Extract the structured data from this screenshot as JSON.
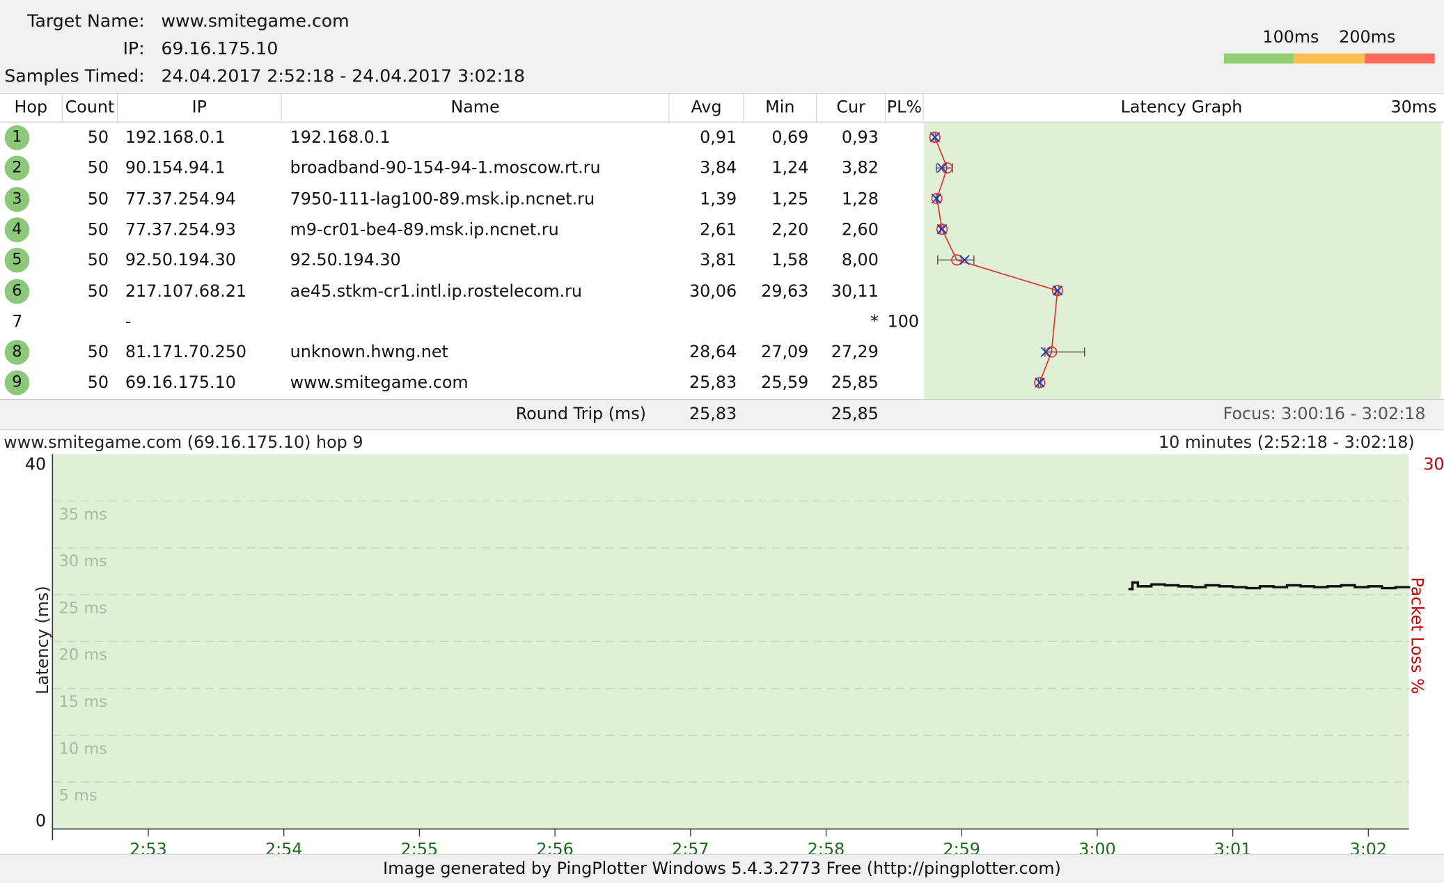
{
  "header": {
    "target_label": "Target Name:",
    "target_value": "www.smitegame.com",
    "ip_label": "IP:",
    "ip_value": "69.16.175.10",
    "samples_label": "Samples Timed:",
    "samples_value": "24.04.2017 2:52:18 - 24.04.2017 3:02:18",
    "legend_100": "100ms",
    "legend_200": "200ms",
    "legend_colors": [
      "#92cf72",
      "#fbbf4f",
      "#fb6a5a"
    ]
  },
  "columns": {
    "hop": "Hop",
    "count": "Count",
    "ip": "IP",
    "name": "Name",
    "avg": "Avg",
    "min": "Min",
    "cur": "Cur",
    "pl": "PL%",
    "graph": "Latency Graph",
    "scale": "30ms"
  },
  "hops": [
    {
      "hop": "1",
      "count": "50",
      "ip": "192.168.0.1",
      "name": "192.168.0.1",
      "avg": "0,91",
      "min": "0,69",
      "cur": "0,93",
      "pl": "",
      "responding": true
    },
    {
      "hop": "2",
      "count": "50",
      "ip": "90.154.94.1",
      "name": "broadband-90-154-94-1.moscow.rt.ru",
      "avg": "3,84",
      "min": "1,24",
      "cur": "3,82",
      "pl": "",
      "responding": true
    },
    {
      "hop": "3",
      "count": "50",
      "ip": "77.37.254.94",
      "name": "7950-111-lag100-89.msk.ip.ncnet.ru",
      "avg": "1,39",
      "min": "1,25",
      "cur": "1,28",
      "pl": "",
      "responding": true
    },
    {
      "hop": "4",
      "count": "50",
      "ip": "77.37.254.93",
      "name": "m9-cr01-be4-89.msk.ip.ncnet.ru",
      "avg": "2,61",
      "min": "2,20",
      "cur": "2,60",
      "pl": "",
      "responding": true
    },
    {
      "hop": "5",
      "count": "50",
      "ip": "92.50.194.30",
      "name": "92.50.194.30",
      "avg": "3,81",
      "min": "1,58",
      "cur": "8,00",
      "pl": "",
      "responding": true
    },
    {
      "hop": "6",
      "count": "50",
      "ip": "217.107.68.21",
      "name": "ae45.stkm-cr1.intl.ip.rostelecom.ru",
      "avg": "30,06",
      "min": "29,63",
      "cur": "30,11",
      "pl": "",
      "responding": true
    },
    {
      "hop": "7",
      "count": "",
      "ip": "-",
      "name": "",
      "avg": "",
      "min": "",
      "cur": "*",
      "pl": "100",
      "responding": false
    },
    {
      "hop": "8",
      "count": "50",
      "ip": "81.171.70.250",
      "name": "unknown.hwng.net",
      "avg": "28,64",
      "min": "27,09",
      "cur": "27,29",
      "pl": "",
      "responding": true
    },
    {
      "hop": "9",
      "count": "50",
      "ip": "69.16.175.10",
      "name": "www.smitegame.com",
      "avg": "25,83",
      "min": "25,59",
      "cur": "25,85",
      "pl": "",
      "responding": true
    }
  ],
  "latency_graph_data": {
    "scale_max_ms": 30,
    "points": [
      {
        "hop": 1,
        "avg": 0.91,
        "min": 0.69,
        "max": 1.1,
        "cur": 0.93
      },
      {
        "hop": 2,
        "avg": 3.84,
        "min": 1.24,
        "max": 5.1,
        "cur": 2.6
      },
      {
        "hop": 3,
        "avg": 1.39,
        "min": 1.25,
        "max": 1.6,
        "cur": 1.28
      },
      {
        "hop": 4,
        "avg": 2.61,
        "min": 2.2,
        "max": 2.9,
        "cur": 2.6
      },
      {
        "hop": 5,
        "avg": 6.12,
        "min": 1.58,
        "max": 10.2,
        "cur": 8.0
      },
      {
        "hop": 6,
        "avg": 30.06,
        "min": 29.63,
        "max": 30.4,
        "cur": 30.11
      },
      {
        "hop": 8,
        "avg": 28.64,
        "min": 27.09,
        "max": 36.5,
        "cur": 27.29
      },
      {
        "hop": 9,
        "avg": 25.83,
        "min": 25.59,
        "max": 26.1,
        "cur": 25.85
      }
    ]
  },
  "round_trip": {
    "label": "Round Trip (ms)",
    "avg": "25,83",
    "cur": "25,85",
    "focus": "Focus: 3:00:16 - 3:02:18"
  },
  "chart_data": {
    "type": "line",
    "title": "www.smitegame.com (69.16.175.10) hop 9",
    "time_range": "10 minutes (2:52:18 - 3:02:18)",
    "ylabel": "Latency (ms)",
    "y2label": "Packet Loss %",
    "ylim": [
      0,
      40
    ],
    "y_ticks": [
      "40",
      "0"
    ],
    "y_grid_labels": [
      "35 ms",
      "30 ms",
      "25 ms",
      "20 ms",
      "15 ms",
      "10 ms",
      "5 ms"
    ],
    "y_grid_values": [
      35,
      30,
      25,
      20,
      15,
      10,
      5
    ],
    "y2_tick": "30",
    "x_ticks": [
      "2:53",
      "2:54",
      "2:55",
      "2:56",
      "2:57",
      "2:58",
      "2:59",
      "3:00",
      "3:01",
      "3:02"
    ],
    "x_tick_minutes": [
      0.7,
      1.7,
      2.7,
      3.7,
      4.7,
      5.7,
      6.7,
      7.7,
      8.7,
      9.7
    ],
    "x_range_minutes": [
      0,
      10
    ],
    "series": [
      {
        "minutes": [
          7.93,
          7.96,
          8.0,
          8.1,
          8.2,
          8.3,
          8.4,
          8.5,
          8.6,
          8.7,
          8.8,
          8.9,
          9.0,
          9.1,
          9.2,
          9.3,
          9.4,
          9.5,
          9.6,
          9.7,
          9.8,
          9.9,
          10.0
        ],
        "latency": [
          25.6,
          26.3,
          25.9,
          26.1,
          26.0,
          25.9,
          25.8,
          26.0,
          25.9,
          25.8,
          25.7,
          25.9,
          25.8,
          26.0,
          25.9,
          25.8,
          25.9,
          26.0,
          25.8,
          25.9,
          25.7,
          25.8,
          25.9
        ]
      }
    ]
  },
  "footer": {
    "text": "Image generated by PingPlotter Windows 5.4.3.2773 Free (http://pingplotter.com)"
  }
}
